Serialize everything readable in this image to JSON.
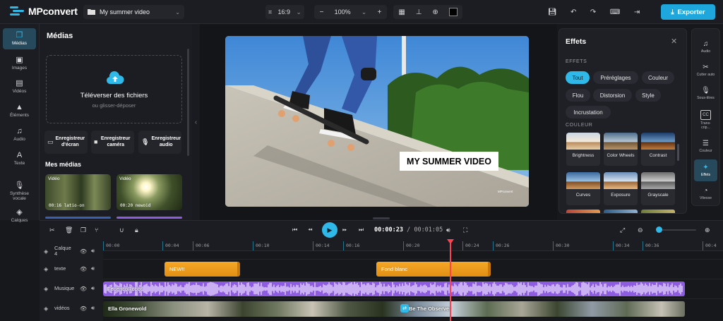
{
  "app": {
    "name": "MPconvert",
    "project_name": "My summer video",
    "export_label": "Exporter"
  },
  "toolbar": {
    "aspect_ratio": "16:9",
    "zoom": "100%"
  },
  "colors": {
    "accent": "#2fb9e8",
    "playhead": "#ff4150",
    "text_clip": "#f39d1d",
    "audio_clip": "#8d5ce0"
  },
  "left_nav": [
    {
      "label": "Médias",
      "icon": "media-icon",
      "active": true
    },
    {
      "label": "Images",
      "icon": "image-icon"
    },
    {
      "label": "Vidéos",
      "icon": "film-icon"
    },
    {
      "label": "Éléments",
      "icon": "shapes-icon"
    },
    {
      "label": "Audio",
      "icon": "music-icon"
    },
    {
      "label": "Texte",
      "icon": "text-icon"
    },
    {
      "label": "Synthèse vocale",
      "icon": "mic-icon"
    },
    {
      "label": "Calques",
      "icon": "layers-icon"
    }
  ],
  "media_panel": {
    "title": "Médias",
    "upload_title": "Téléverser des fichiers",
    "upload_sub": "ou glisser-déposer",
    "recorders": [
      {
        "label": "Enregistreur d'écran",
        "icon": "monitor-icon"
      },
      {
        "label": "Enregistreur caméra",
        "icon": "camera-icon"
      },
      {
        "label": "Enregistreur audio",
        "icon": "mic-icon"
      }
    ],
    "my_media_title": "Mes médias",
    "items": [
      {
        "tag": "Vidéo",
        "duration": "00:16",
        "name": "latio-on"
      },
      {
        "tag": "Vidéo",
        "duration": "00:20",
        "name": "newoid"
      }
    ]
  },
  "preview": {
    "overlay_text": "MY SUMMER VIDEO",
    "watermark": "MPconvert"
  },
  "effects_panel": {
    "title": "Effets",
    "section_label": "EFFETS",
    "chips": [
      {
        "label": "Tout",
        "active": true
      },
      {
        "label": "Préréglages"
      },
      {
        "label": "Couleur"
      },
      {
        "label": "Flou"
      },
      {
        "label": "Distorsion"
      },
      {
        "label": "Style"
      },
      {
        "label": "Incrustation"
      }
    ],
    "color_section_label": "COULEUR",
    "color_effects": [
      "Brightness",
      "Color Wheels",
      "Contrast",
      "Curves",
      "Exposure",
      "Grayscale"
    ]
  },
  "right_rail": [
    {
      "label": "Audio",
      "icon": "music-icon"
    },
    {
      "label": "Cutter auto",
      "icon": "scissors-icon"
    },
    {
      "label": "Sous-titres",
      "icon": "mic-icon"
    },
    {
      "label": "Trans-crip...",
      "icon": "cc-icon"
    },
    {
      "label": "Couleur",
      "icon": "sliders-icon"
    },
    {
      "label": "Effets",
      "icon": "magic-wand-icon",
      "active": true
    },
    {
      "label": "Vitesse",
      "icon": "speed-icon"
    }
  ],
  "playback": {
    "current_time": "00:00:23",
    "separator": "/",
    "total_time": "00:01:05"
  },
  "timeline": {
    "ruler_labels": [
      "00:00",
      "00:04",
      "00:06",
      "00:10",
      "00:14",
      "00:16",
      "00:20",
      "00:24",
      "00:26",
      "00:30",
      "00:34",
      "00:36",
      "00:4"
    ],
    "tracks": [
      {
        "name": "Calque 4"
      },
      {
        "name": "texte"
      },
      {
        "name": "Musique"
      },
      {
        "name": "vidéos"
      }
    ],
    "text_clips": [
      "NEW!!",
      "Fond blanc"
    ],
    "audio_clip_name": "FedericoRobot",
    "video_clips": [
      "Ella Gronewold",
      "Be The Observer"
    ]
  }
}
